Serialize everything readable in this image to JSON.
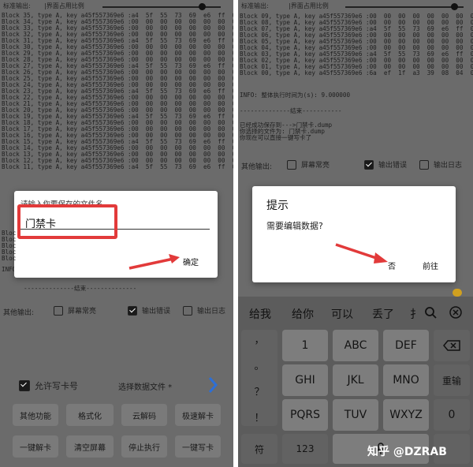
{
  "left": {
    "topbar": {
      "std_output": "标准输出:",
      "ratio_label": "|界面占用比例"
    },
    "log_lines": [
      "Block 35, type A, key a45f557369e6 :a4  5f  55  73  69  e6  ff  0",
      "Block 34, type A, key a45f557369e6 :00  00  00  00  00  00  00  0",
      "Block 33, type A, key a45f557369e6 :00  00  00  00  00  00  00  0",
      "Block 32, type A, key a45f557369e6 :00  00  00  00  00  00  00  0",
      "Block 31, type A, key a45f557369e6 :a4  5f  55  73  69  e6  ff  0",
      "Block 30, type A, key a45f557369e6 :00  00  00  00  00  00  00  0",
      "Block 29, type A, key a45f557369e6 :00  00  00  00  00  00  00  0",
      "Block 28, type A, key a45f557369e6 :00  00  00  00  00  00  00  0",
      "Block 27, type A, key a45f557369e6 :a4  5f  55  73  69  e6  ff  0",
      "Block 26, type A, key a45f557369e6 :00  00  00  00  00  00  00  0",
      "Block 25, type A, key a45f557369e6 :00  00  00  00  00  00  00  0",
      "Block 24, type A, key a45f557369e6 :00  00  00  00  00  00  00  0",
      "Block 23, type A, key a45f557369e6 :a4  5f  55  73  69  e6  ff  0",
      "Block 22, type A, key a45f557369e6 :00  00  00  00  00  00  00  0",
      "Block 21, type A, key a45f557369e6 :00  00  00  00  00  00  00  0",
      "Block 20, type A, key a45f557369e6 :00  00  00  00  00  00  00  0",
      "Block 19, type A, key a45f557369e6 :a4  5f  55  73  69  e6  ff  0",
      "Block 18, type A, key a45f557369e6 :00  00  00  00  00  00  00  0",
      "Block 17, type A, key a45f557369e6 :00  00  00  00  00  00  00  0",
      "Block 16, type A, key a45f557369e6 :00  00  00  00  00  00  00  0",
      "Block 15, type A, key a45f557369e6 :a4  5f  55  73  69  e6  ff  0",
      "Block 14, type A, key a45f557369e6 :00  00  00  00  00  00  00  0",
      "Block 13, type A, key a45f557369e6 :00  00  00  00  00  00  00  0",
      "Block 12, type A, key a45f557369e6 :00  00  00  00  00  00  00  0",
      "Block 11, type A, key a45f557369e6 :a4  5f  55  73  69  e6  ff  0"
    ],
    "bottom_partial_lines": [
      "Bloc",
      "Bloc",
      "Bloc",
      "Bloc",
      "Bloc"
    ],
    "info_partial": "INFO",
    "end_marker": "--------------结束--------------",
    "options": {
      "label": "其他输出:",
      "screen_on": "屏幕常亮",
      "output_error": "输出错误",
      "output_log": "输出日志"
    },
    "allow_write_card": "允许写卡号",
    "select_data_file": "选择数据文件 *",
    "buttons_row1": [
      "其他功能",
      "格式化",
      "云解码",
      "极速解卡"
    ],
    "buttons_row2": [
      "一键解卡",
      "清空屏幕",
      "停止执行",
      "一键写卡"
    ],
    "dialog": {
      "prompt": "请输入你要保存的文件名",
      "value": "门禁卡",
      "confirm": "确定"
    }
  },
  "right": {
    "topbar": {
      "std_output": "标准输出:",
      "ratio_label": "|界面占用比例"
    },
    "log_lines": [
      "Block 09, type A, key a45f557369e6 :00  00  00  00  00  00  00  0",
      "Block 08, type A, key a45f557369e6 :00  00  00  00  00  00  00  0",
      "Block 07, type A, key a45f557369e6 :a4  5f  55  73  69  e6  ff  0",
      "Block 06, type A, key a45f557369e6 :00  00  00  00  00  00  00  0",
      "Block 05, type A, key a45f557369e6 :00  00  00  00  00  00  00  0",
      "Block 04, type A, key a45f557369e6 :00  00  00  00  00  00  00  0",
      "Block 03, type A, key a45f557369e6 :a4  5f  55  73  69  e6  ff  0",
      "Block 02, type A, key a45f557369e6 :00  00  00  00  00  00  00  0",
      "Block 01, type A, key a45f557369e6 :00  00  00  00  00  00  00  0",
      "Block 00, type A, key a45f557369e6 :6a  ef  1f  a3  39  08  04  0"
    ],
    "info_line": "INFO: 整体执行时间为(s): 9.000000",
    "end_marker": "--------------结束-----------",
    "saved_lines": [
      "已经成功保存到--->门禁卡.dump",
      "你选择的文件为: 门禁卡.dump",
      "你现在可以直接一键写卡了"
    ],
    "options": {
      "label": "其他输出:",
      "screen_on": "屏幕常亮",
      "output_error": "输出错误",
      "output_log": "输出日志"
    },
    "dialog": {
      "title": "提示",
      "message": "需要编辑数据?",
      "no": "否",
      "go": "前往"
    },
    "keyboard": {
      "suggestions": [
        "给我",
        "给你",
        "可以",
        "丢了",
        "扌"
      ],
      "col1": [
        "，",
        "。",
        "？",
        "！"
      ],
      "row_keys": [
        [
          "1",
          "ABC",
          "DEF"
        ],
        [
          "GHI",
          "JKL",
          "MNO"
        ],
        [
          "PQRS",
          "TUV",
          "WXYZ"
        ]
      ],
      "enter": "重输",
      "zero": "0",
      "symbol": "符",
      "num": "123"
    },
    "watermark": "知乎 @DZRAB"
  }
}
